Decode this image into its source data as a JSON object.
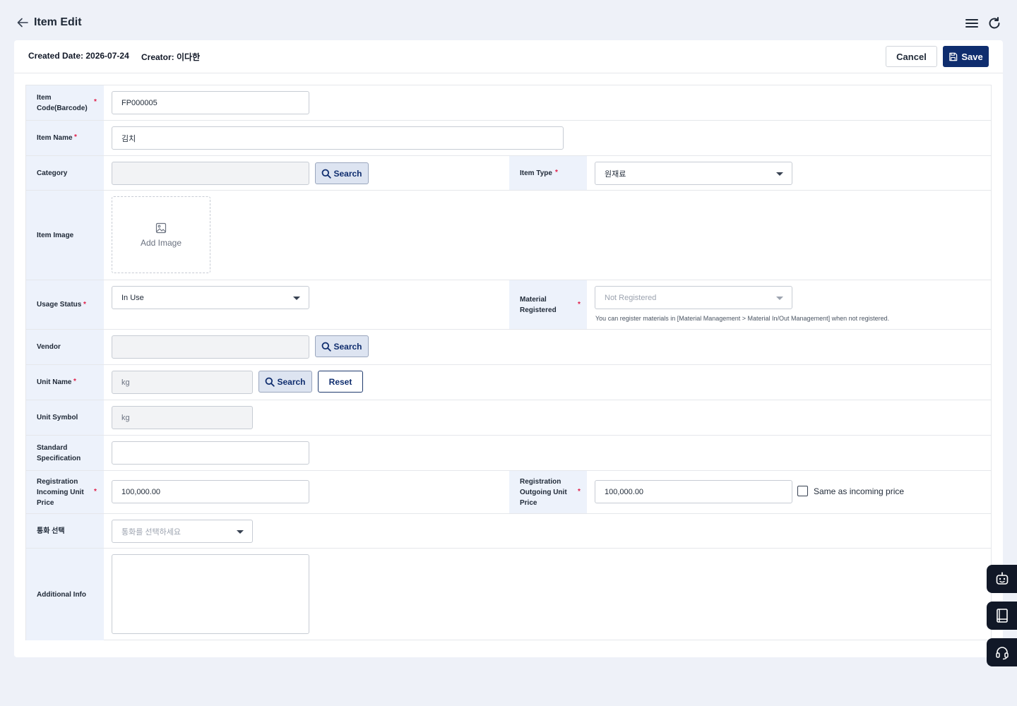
{
  "header": {
    "title": "Item Edit"
  },
  "meta": {
    "created": "Created Date: 2026-07-24",
    "creator": "Creator: 이다한"
  },
  "actions": {
    "cancel_label": "Cancel",
    "save_label": "Save"
  },
  "form": {
    "item_code": {
      "label": "Item Code(Barcode)",
      "value": "FP000005"
    },
    "item_name": {
      "label": "Item Name",
      "value": "김치"
    },
    "category": {
      "label": "Category",
      "value": "",
      "search_label": "Search"
    },
    "item_type": {
      "label": "Item Type",
      "value": "원재료"
    },
    "item_image": {
      "label": "Item Image",
      "add_label": "Add Image"
    },
    "usage_status": {
      "label": "Usage Status",
      "value": "In Use"
    },
    "material_registered": {
      "label": "Material Registered",
      "placeholder": "Not Registered",
      "hint": "You can register materials in [Material Management > Material In/Out Management] when not registered."
    },
    "vendor": {
      "label": "Vendor",
      "value": "",
      "search_label": "Search"
    },
    "unit_name": {
      "label": "Unit Name",
      "value": "kg",
      "search_label": "Search",
      "reset_label": "Reset"
    },
    "unit_symbol": {
      "label": "Unit Symbol",
      "value": "kg"
    },
    "standard_spec": {
      "label": "Standard Specification",
      "value": ""
    },
    "incoming_price": {
      "label": "Registration Incoming Unit Price",
      "value": "100,000.00"
    },
    "outgoing_price": {
      "label": "Registration Outgoing Unit Price",
      "value": "100,000.00",
      "same_label": "Same as incoming price"
    },
    "currency": {
      "label": "통화 선택",
      "placeholder": "통화를 선택하세요"
    },
    "additional_info": {
      "label": "Additional Info",
      "value": ""
    }
  },
  "colors": {
    "primary": "#0f2d6e",
    "label_bg": "#edf2fb",
    "required": "#e11d48"
  }
}
